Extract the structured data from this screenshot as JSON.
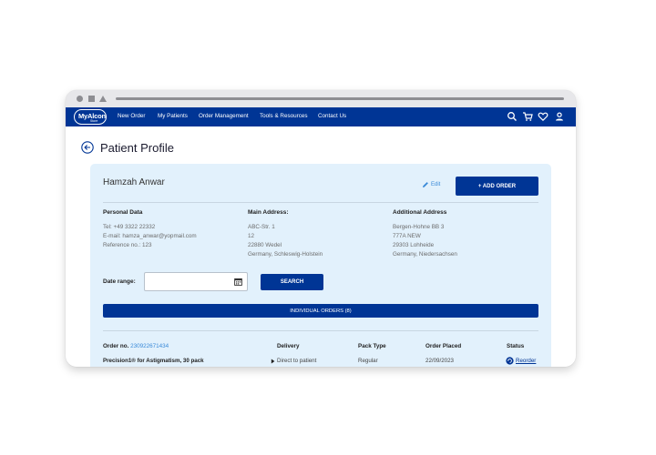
{
  "nav": {
    "logo": {
      "main": "MyAlcon",
      "sub": "Store"
    },
    "links": [
      "New Order",
      "My Patients",
      "Order Management",
      "Tools & Resources",
      "Contact Us"
    ],
    "icons": [
      "search-icon",
      "cart-icon",
      "heart-icon",
      "user-icon"
    ]
  },
  "page": {
    "title": "Patient Profile"
  },
  "patient": {
    "name": "Hamzah Anwar",
    "edit_label": "Edit",
    "add_order_label": "+ ADD ORDER",
    "personal": {
      "heading": "Personal Data",
      "lines": [
        "Tel: +49 3322 22332",
        "E-mail: hamza_anwar@yopmail.com",
        "Reference no.: 123"
      ]
    },
    "main_address": {
      "heading": "Main Address:",
      "lines": [
        "ABC-Str. 1",
        "12",
        "22880 Wedel",
        "Germany, Schleswig-Holstein"
      ]
    },
    "additional_address": {
      "heading": "Additional Address",
      "lines": [
        "Bergen-Hohne BB 3",
        "777A NEW",
        "29303 Lohheide",
        "Germany, Niedersachsen"
      ]
    }
  },
  "filter": {
    "date_label": "Date range:",
    "date_value": "",
    "search_label": "SEARCH"
  },
  "orders_bar_label": "INDIVIDUAL ORDERS (8)",
  "orders_table": {
    "headers": {
      "order_no": "Order no.",
      "delivery": "Delivery",
      "pack_type": "Pack Type",
      "order_placed": "Order Placed",
      "status": "Status"
    },
    "rows": [
      {
        "order_no": "230922671434",
        "product": "Precision1® for Astigmatism, 30 pack",
        "delivery": "Direct to patient",
        "pack_type": "Regular",
        "order_placed": "22/09/2023",
        "status": "Reorder"
      }
    ]
  },
  "colors": {
    "brand_blue": "#003595",
    "card_bg": "#e2f1fc",
    "link_blue": "#3a8ad8"
  }
}
